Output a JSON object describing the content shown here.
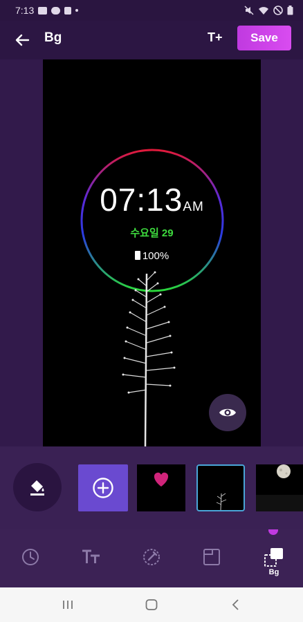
{
  "status_bar": {
    "time": "7:13"
  },
  "app_bar": {
    "title": "Bg",
    "text_add_label": "T+",
    "save_label": "Save"
  },
  "preview": {
    "clock_time": "07:13",
    "clock_ampm": "AM",
    "date": "수요일 29",
    "battery": "100%"
  },
  "tabs": [
    {
      "name": "clock",
      "icon": "clock-icon"
    },
    {
      "name": "text",
      "icon": "text-size-icon"
    },
    {
      "name": "color",
      "icon": "color-picker-icon"
    },
    {
      "name": "layout",
      "icon": "frame-icon"
    },
    {
      "name": "bg",
      "icon": "background-icon",
      "label": "Bg"
    }
  ],
  "colors": {
    "accent": "#c03ae0",
    "add_button": "#6a4ad0",
    "date_green": "#3edb3e",
    "selected_border": "#4aa6d8"
  }
}
